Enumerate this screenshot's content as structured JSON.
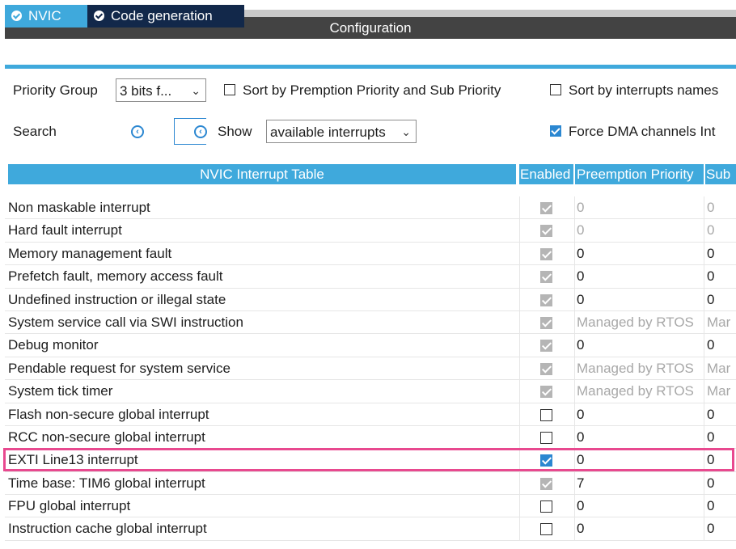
{
  "header": {
    "title": "Configuration"
  },
  "tabs": [
    {
      "label": "NVIC",
      "active": true
    },
    {
      "label": "Code generation",
      "active": false
    }
  ],
  "toolbar": {
    "priority_group_label": "Priority Group",
    "priority_group_value": "3 bits f...",
    "sort_premption_label": "Sort by Premption Priority and Sub Priority",
    "sort_interrupts_label": "Sort by interrupts names",
    "search_label": "Search",
    "show_label": "Show",
    "show_value": "available interrupts",
    "force_dma_label": "Force DMA channels Int",
    "force_dma_checked": true
  },
  "table": {
    "headers": {
      "name": "NVIC Interrupt Table",
      "enabled": "Enabled",
      "preemption": "Preemption Priority",
      "sub": "Sub"
    },
    "rows": [
      {
        "name": "Non maskable interrupt",
        "enabled": "disabled-checked",
        "pre": "0",
        "sub": "0",
        "muted": true
      },
      {
        "name": "Hard fault interrupt",
        "enabled": "disabled-checked",
        "pre": "0",
        "sub": "0",
        "muted": true
      },
      {
        "name": "Memory management fault",
        "enabled": "disabled-checked",
        "pre": "0",
        "sub": "0",
        "muted": false
      },
      {
        "name": "Prefetch fault, memory access fault",
        "enabled": "disabled-checked",
        "pre": "0",
        "sub": "0",
        "muted": false
      },
      {
        "name": "Undefined instruction or illegal state",
        "enabled": "disabled-checked",
        "pre": "0",
        "sub": "0",
        "muted": false
      },
      {
        "name": "System service call via SWI instruction",
        "enabled": "disabled-checked",
        "pre": "Managed by RTOS",
        "sub": "Mar",
        "muted": true
      },
      {
        "name": "Debug monitor",
        "enabled": "disabled-checked",
        "pre": "0",
        "sub": "0",
        "muted": false
      },
      {
        "name": "Pendable request for system service",
        "enabled": "disabled-checked",
        "pre": "Managed by RTOS",
        "sub": "Mar",
        "muted": true
      },
      {
        "name": "System tick timer",
        "enabled": "disabled-checked",
        "pre": "Managed by RTOS",
        "sub": "Mar",
        "muted": true
      },
      {
        "name": "Flash non-secure global interrupt",
        "enabled": "unchecked",
        "pre": "0",
        "sub": "0",
        "muted": false
      },
      {
        "name": "RCC non-secure global interrupt",
        "enabled": "unchecked",
        "pre": "0",
        "sub": "0",
        "muted": false
      },
      {
        "name": "EXTI Line13 interrupt",
        "enabled": "checked",
        "pre": "0",
        "sub": "0",
        "muted": false
      },
      {
        "name": "Time base: TIM6 global interrupt",
        "enabled": "disabled-checked",
        "pre": "7",
        "sub": "0",
        "muted": false
      },
      {
        "name": "FPU global interrupt",
        "enabled": "unchecked",
        "pre": "0",
        "sub": "0",
        "muted": false
      },
      {
        "name": "Instruction cache global interrupt",
        "enabled": "unchecked",
        "pre": "0",
        "sub": "0",
        "muted": false
      }
    ],
    "highlighted_row": 11
  },
  "colors": {
    "accent": "#3fa9dc",
    "header_dark": "#434343",
    "tab_dark": "#12284a",
    "highlight": "#e8498f",
    "check_blue": "#2b87d1"
  }
}
